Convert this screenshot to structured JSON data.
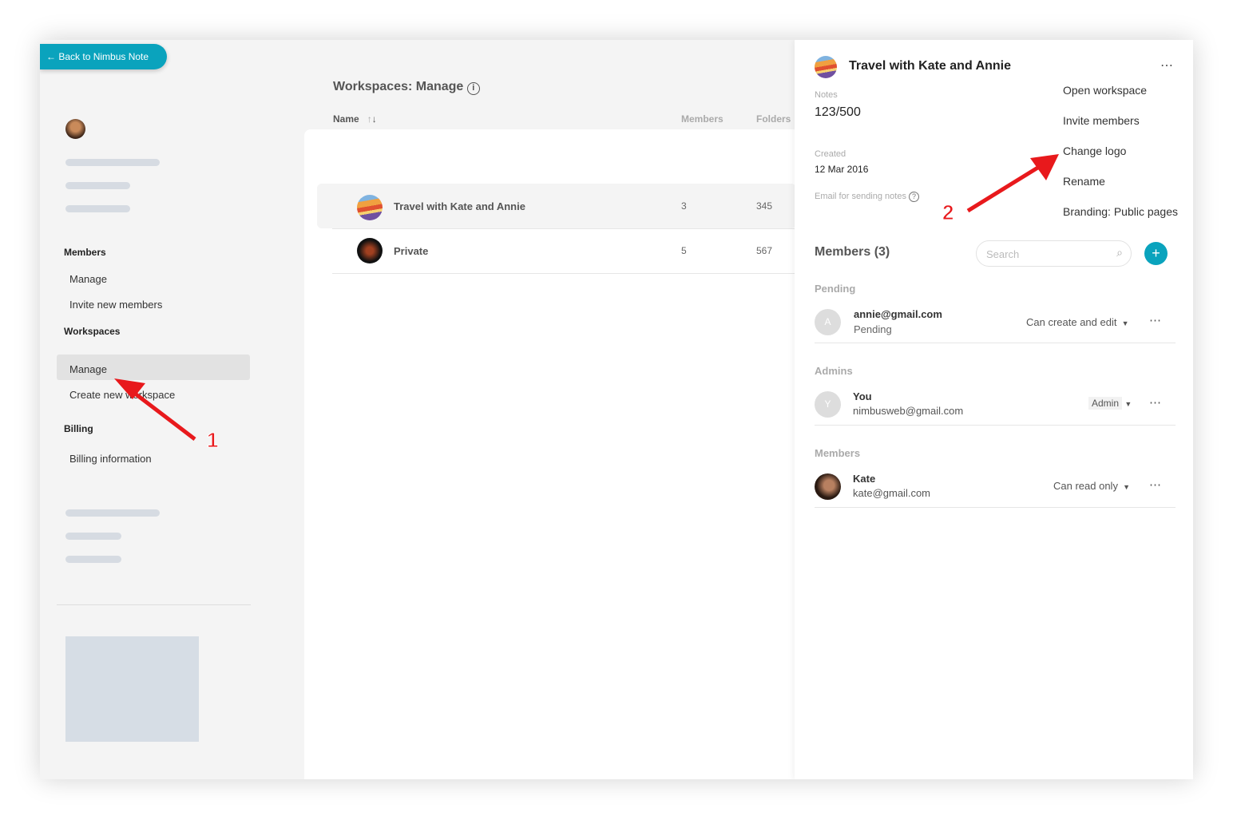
{
  "back_button": {
    "label": "Back to Nimbus Note",
    "icon": "arrow-left-icon"
  },
  "sidebar": {
    "sections": [
      {
        "title": "Members",
        "items": [
          "Manage",
          "Invite new members"
        ]
      },
      {
        "title": "Workspaces",
        "items": [
          "Manage",
          "Create new workspace"
        ]
      },
      {
        "title": "Billing",
        "items": [
          "Billing information"
        ]
      }
    ],
    "selected": "Workspaces > Manage"
  },
  "main": {
    "title": "Workspaces: Manage",
    "columns": {
      "name": "Name",
      "members": "Members",
      "folders": "Folders"
    },
    "rows": [
      {
        "name": "Travel with Kate and Annie",
        "members": "3",
        "folders": "345"
      },
      {
        "name": "Private",
        "members": "5",
        "folders": "567"
      }
    ]
  },
  "panel": {
    "title": "Travel with Kate and Annie",
    "notes_label": "Notes",
    "notes_value": "123/500",
    "created_label": "Created",
    "created_value": "12 Mar 2016",
    "email_label": "Email for sending notes",
    "menu": [
      "Open workspace",
      "Invite members",
      "Change logo",
      "Rename",
      "Branding: Public pages"
    ],
    "members_title": "Members (3)",
    "search_placeholder": "Search",
    "groups": [
      {
        "title": "Pending",
        "members": [
          {
            "initial": "A",
            "name": "annie@gmail.com",
            "sub": "Pending",
            "role": "Can create and edit"
          }
        ]
      },
      {
        "title": "Admins",
        "members": [
          {
            "initial": "Y",
            "name": "You",
            "sub": "nimbusweb@gmail.com",
            "role": "Admin"
          }
        ]
      },
      {
        "title": "Members",
        "members": [
          {
            "initial": "",
            "name": "Kate",
            "sub": "kate@gmail.com",
            "role": "Can read only"
          }
        ]
      }
    ]
  },
  "annotations": [
    "1",
    "2"
  ],
  "colors": {
    "accent": "#0aa3bd",
    "annotation": "#e8191c"
  }
}
